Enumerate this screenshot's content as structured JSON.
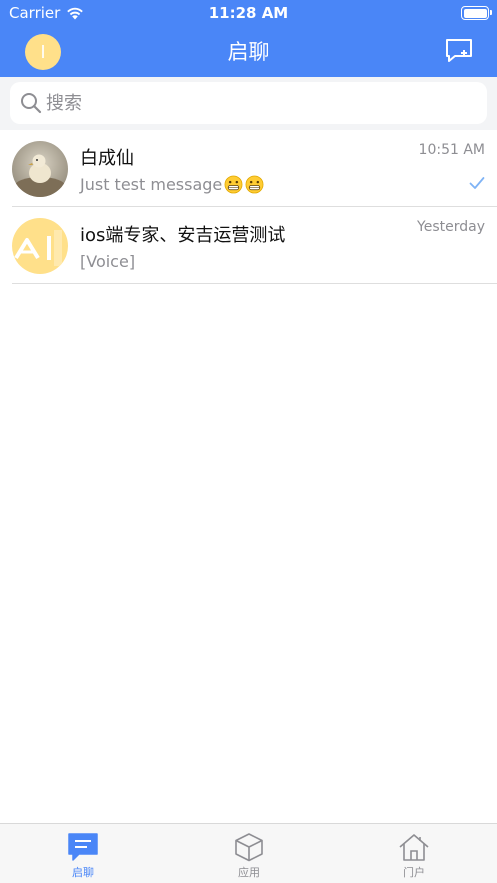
{
  "status_bar": {
    "carrier": "Carrier",
    "time": "11:28 AM"
  },
  "nav": {
    "title": "启聊",
    "avatar_initial": "I",
    "compose_icon": "compose-message-icon"
  },
  "search": {
    "placeholder": "搜索"
  },
  "chats": [
    {
      "name": "白成仙",
      "preview": "Just test message",
      "time": "10:51 AM",
      "read": true,
      "avatar": "photo-duck"
    },
    {
      "name": "ios端专家、安吉运营测试",
      "preview": "[Voice]",
      "time": "Yesterday",
      "read": false,
      "avatar": "logo-ai"
    }
  ],
  "tabs": [
    {
      "label": "启聊",
      "icon": "chat-bubble-icon",
      "active": true
    },
    {
      "label": "应用",
      "icon": "cube-icon",
      "active": false
    },
    {
      "label": "门户",
      "icon": "home-icon",
      "active": false
    }
  ],
  "colors": {
    "accent": "#4a86f7",
    "inactive": "#8e8e93",
    "avatar_yellow": "#ffe08a"
  }
}
